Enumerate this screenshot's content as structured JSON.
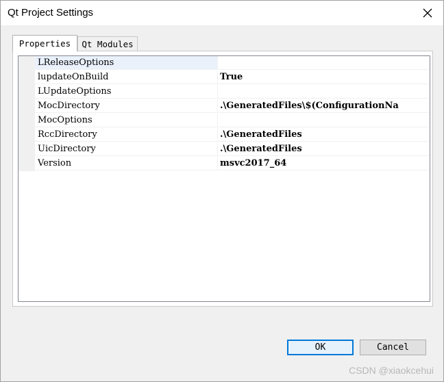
{
  "window": {
    "title": "Qt Project Settings",
    "close_icon": "close-icon"
  },
  "tabs": [
    {
      "label": "Properties",
      "active": true
    },
    {
      "label": "Qt Modules",
      "active": false
    }
  ],
  "properties": [
    {
      "name": "LReleaseOptions",
      "value": ""
    },
    {
      "name": "lupdateOnBuild",
      "value": "True"
    },
    {
      "name": "LUpdateOptions",
      "value": ""
    },
    {
      "name": "MocDirectory",
      "value": ".\\GeneratedFiles\\$(ConfigurationNa"
    },
    {
      "name": "MocOptions",
      "value": ""
    },
    {
      "name": "RccDirectory",
      "value": ".\\GeneratedFiles"
    },
    {
      "name": "UicDirectory",
      "value": ".\\GeneratedFiles"
    },
    {
      "name": "Version",
      "value": "msvc2017_64"
    }
  ],
  "buttons": {
    "ok_label": "OK",
    "cancel_label": "Cancel"
  },
  "watermark": "CSDN @xiaokcehui",
  "colors": {
    "dialog_bg": "#f0f0f0",
    "selected_row_bg": "#eaf1fb",
    "default_button_border": "#0078d7"
  }
}
